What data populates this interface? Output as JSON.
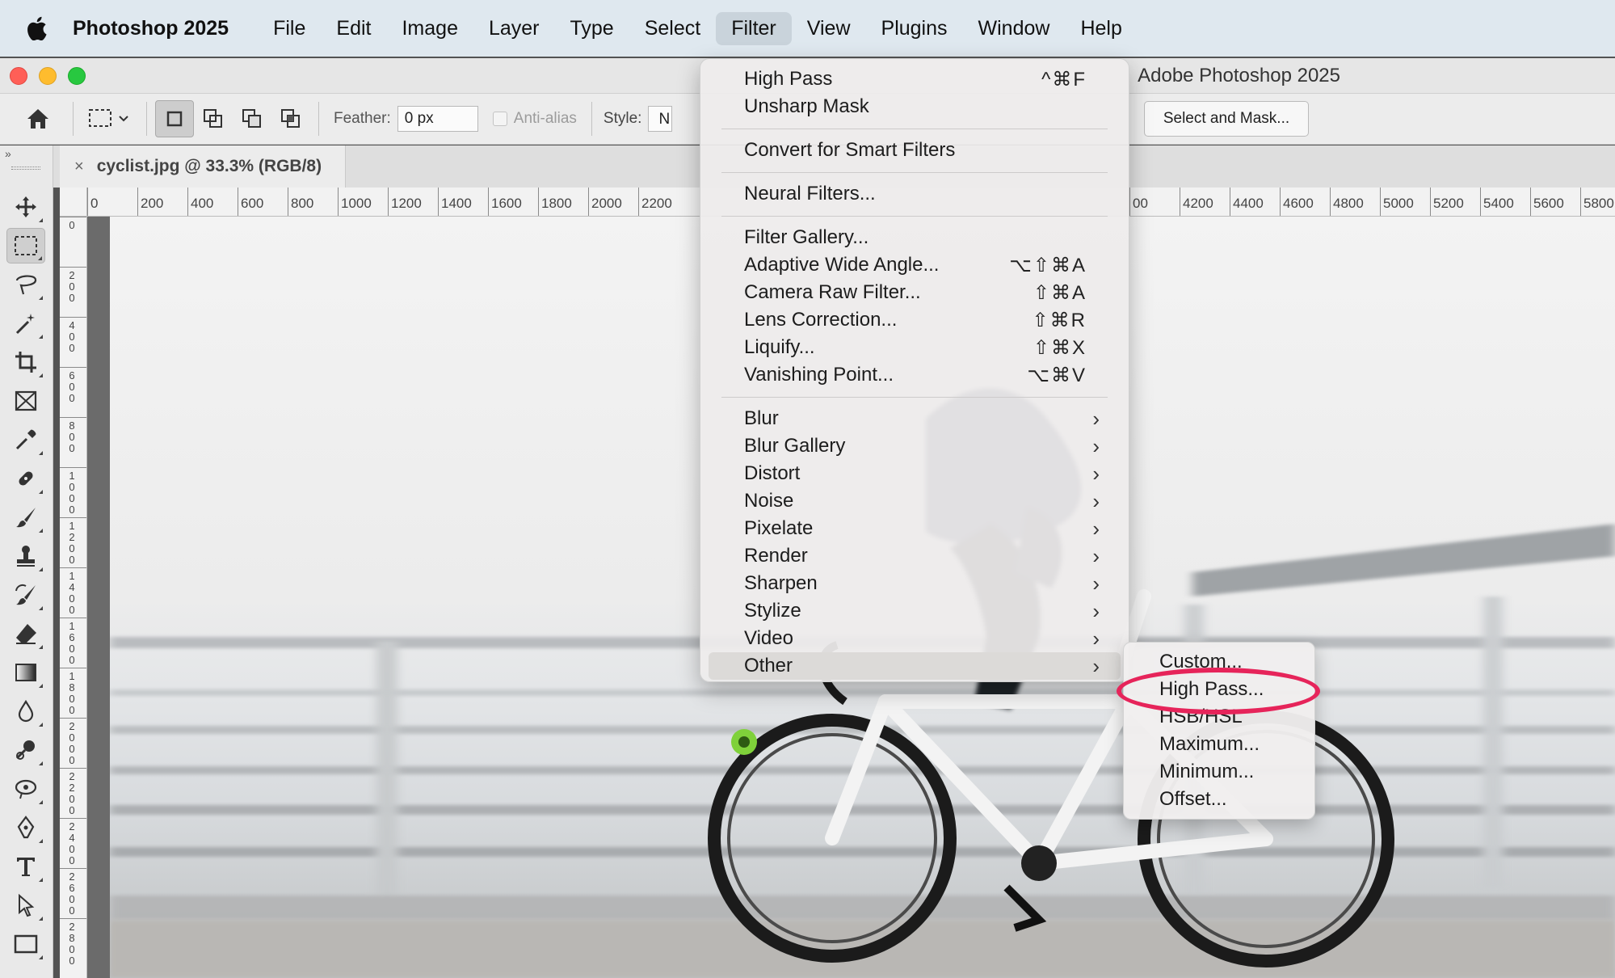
{
  "menubar": {
    "app_name": "Photoshop 2025",
    "items": [
      "File",
      "Edit",
      "Image",
      "Layer",
      "Type",
      "Select",
      "Filter",
      "View",
      "Plugins",
      "Window",
      "Help"
    ],
    "active_item": "Filter"
  },
  "window": {
    "title": "Adobe Photoshop 2025"
  },
  "options_bar": {
    "feather_label": "Feather:",
    "feather_value": "0 px",
    "antialias_label": "Anti-alias",
    "style_label": "Style:",
    "style_value": "N",
    "select_mask_label": "Select and Mask..."
  },
  "document": {
    "tab_title": "cyclist.jpg @ 33.3% (RGB/8)",
    "close_glyph": "×"
  },
  "rulers": {
    "top_ticks_left": [
      "0",
      "200",
      "400",
      "600",
      "800",
      "1000",
      "1200",
      "1400",
      "1600",
      "1800",
      "2000",
      "2200"
    ],
    "top_ticks_right": [
      "00",
      "4200",
      "4400",
      "4600",
      "4800",
      "5000",
      "5200",
      "5400",
      "5600",
      "5800"
    ],
    "left_ticks": [
      "0",
      "200",
      "400",
      "600",
      "800",
      "1000",
      "1200",
      "1400",
      "1600",
      "1800",
      "2000",
      "2200",
      "2400",
      "2600",
      "2800"
    ]
  },
  "filter_menu": {
    "items": [
      {
        "label": "High Pass",
        "shortcut": "^⌘F"
      },
      {
        "label": "Unsharp Mask",
        "shortcut": ""
      },
      {
        "label": "Convert for Smart Filters",
        "shortcut": ""
      },
      {
        "label": "Neural Filters...",
        "shortcut": ""
      },
      {
        "label": "Filter Gallery...",
        "shortcut": ""
      },
      {
        "label": "Adaptive Wide Angle...",
        "shortcut": "⌥⇧⌘A"
      },
      {
        "label": "Camera Raw Filter...",
        "shortcut": "⇧⌘A"
      },
      {
        "label": "Lens Correction...",
        "shortcut": "⇧⌘R"
      },
      {
        "label": "Liquify...",
        "shortcut": "⇧⌘X"
      },
      {
        "label": "Vanishing Point...",
        "shortcut": "⌥⌘V"
      },
      {
        "label": "Blur",
        "shortcut": ""
      },
      {
        "label": "Blur Gallery",
        "shortcut": ""
      },
      {
        "label": "Distort",
        "shortcut": ""
      },
      {
        "label": "Noise",
        "shortcut": ""
      },
      {
        "label": "Pixelate",
        "shortcut": ""
      },
      {
        "label": "Render",
        "shortcut": ""
      },
      {
        "label": "Sharpen",
        "shortcut": ""
      },
      {
        "label": "Stylize",
        "shortcut": ""
      },
      {
        "label": "Video",
        "shortcut": ""
      },
      {
        "label": "Other",
        "shortcut": ""
      }
    ],
    "highlighted": "Other",
    "submenu_chevron": "›"
  },
  "other_submenu": {
    "items": [
      "Custom...",
      "High Pass...",
      "HSB/HSL",
      "Maximum...",
      "Minimum...",
      "Offset..."
    ],
    "circled_item": "High Pass..."
  },
  "colors": {
    "annotation_ring": "#e6245a",
    "menubar_bg": "#dfe8ef",
    "menu_highlight": "#dcdad8"
  }
}
